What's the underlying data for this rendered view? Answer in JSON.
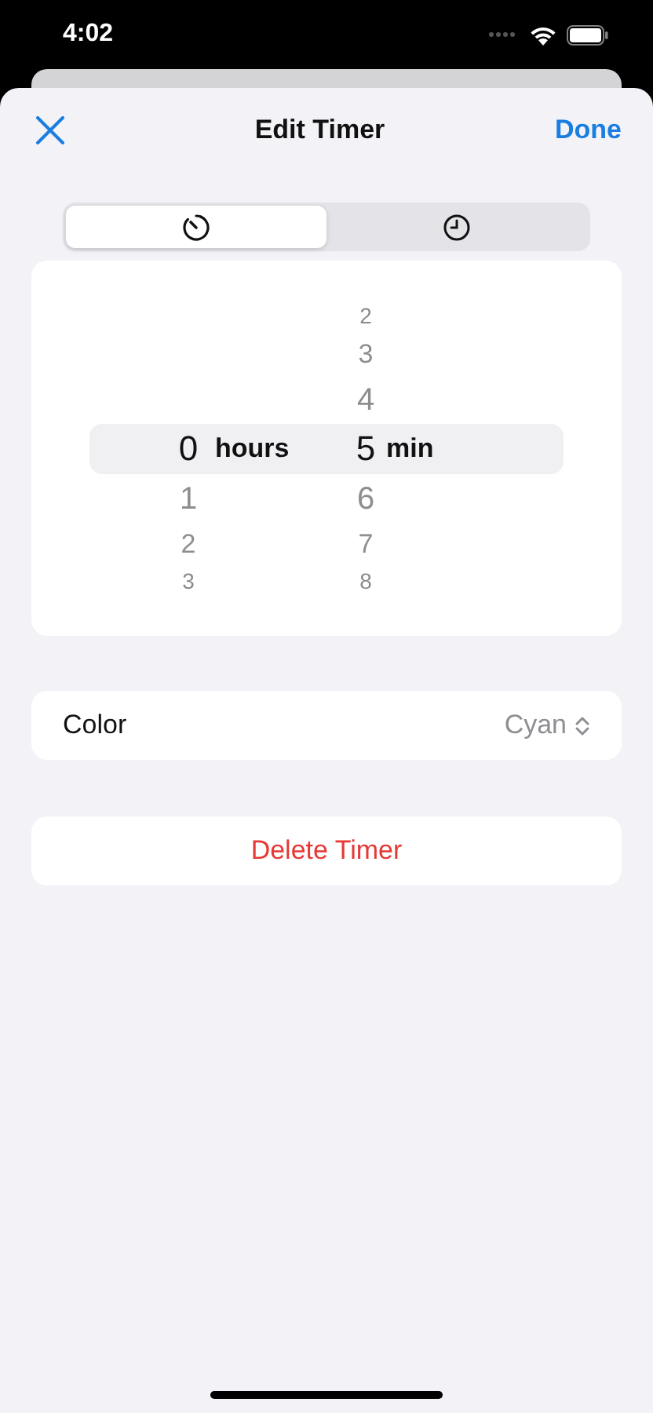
{
  "status_bar": {
    "time": "4:02"
  },
  "nav": {
    "title": "Edit Timer",
    "done": "Done"
  },
  "modes": [
    {
      "kind": "timer",
      "selected": true
    },
    {
      "kind": "clock",
      "selected": false
    }
  ],
  "picker": {
    "columns": [
      {
        "unit": "hours",
        "values": [
          {
            "text": "0",
            "selected": true
          },
          {
            "text": "1",
            "selected": false
          },
          {
            "text": "2",
            "selected": false
          },
          {
            "text": "3",
            "selected": false
          }
        ]
      },
      {
        "unit": "min",
        "values": [
          {
            "text": "2",
            "selected": false
          },
          {
            "text": "3",
            "selected": false
          },
          {
            "text": "4",
            "selected": false
          },
          {
            "text": "5",
            "selected": true
          },
          {
            "text": "6",
            "selected": false
          },
          {
            "text": "7",
            "selected": false
          },
          {
            "text": "8",
            "selected": false
          }
        ]
      }
    ]
  },
  "color_row": {
    "label": "Color",
    "value": "Cyan"
  },
  "delete_button": "Delete Timer"
}
